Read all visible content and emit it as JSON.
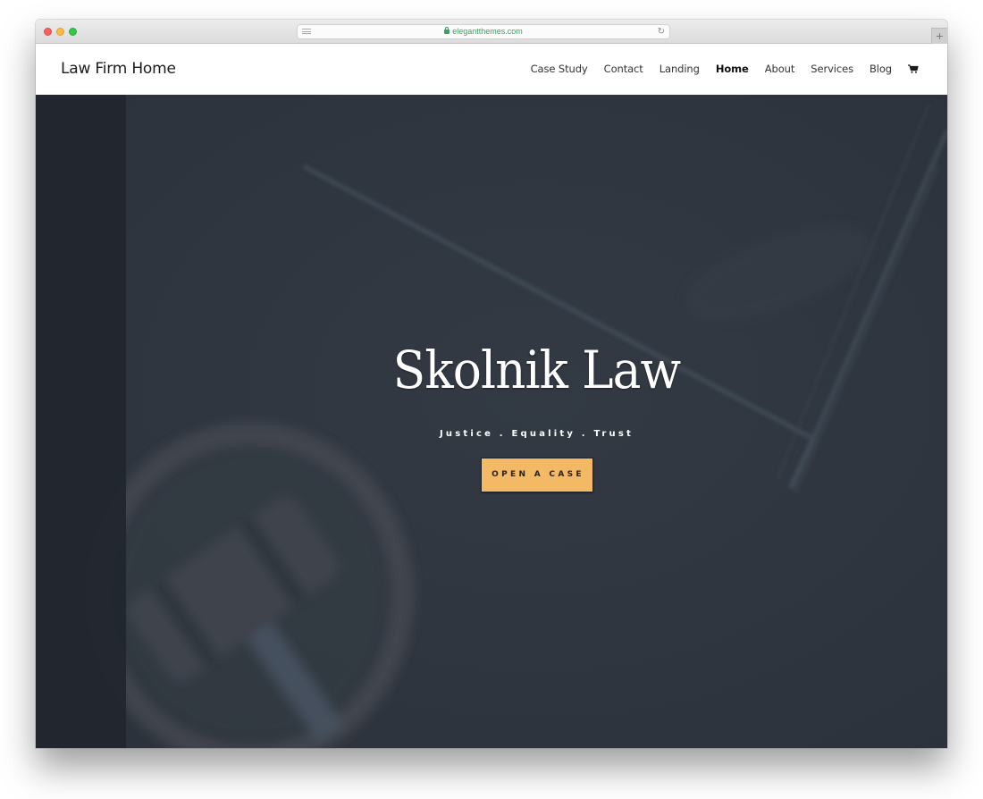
{
  "browser": {
    "url": "elegantthemes.com",
    "icons": {
      "close": "close-window-dot",
      "minimize": "minimize-window-dot",
      "maximize": "maximize-window-dot",
      "reader": "reader-view-icon",
      "lock": "lock-icon",
      "reload": "reload-icon",
      "new_tab": "plus-icon"
    },
    "new_tab_label": "+",
    "reload_glyph": "↻"
  },
  "header": {
    "logo": "Law Firm Home",
    "nav": [
      {
        "label": "Case Study",
        "active": false
      },
      {
        "label": "Contact",
        "active": false
      },
      {
        "label": "Landing",
        "active": false
      },
      {
        "label": "Home",
        "active": true
      },
      {
        "label": "About",
        "active": false
      },
      {
        "label": "Services",
        "active": false
      },
      {
        "label": "Blog",
        "active": false
      }
    ],
    "cart_icon": "shopping-cart-icon"
  },
  "hero": {
    "title": "Skolnik Law",
    "tagline": "Justice . Equality . Trust",
    "cta_label": "OPEN A CASE",
    "colors": {
      "background": "#323943",
      "sidebar": "#20262e",
      "cta": "#f3b965",
      "text": "#ffffff"
    }
  }
}
